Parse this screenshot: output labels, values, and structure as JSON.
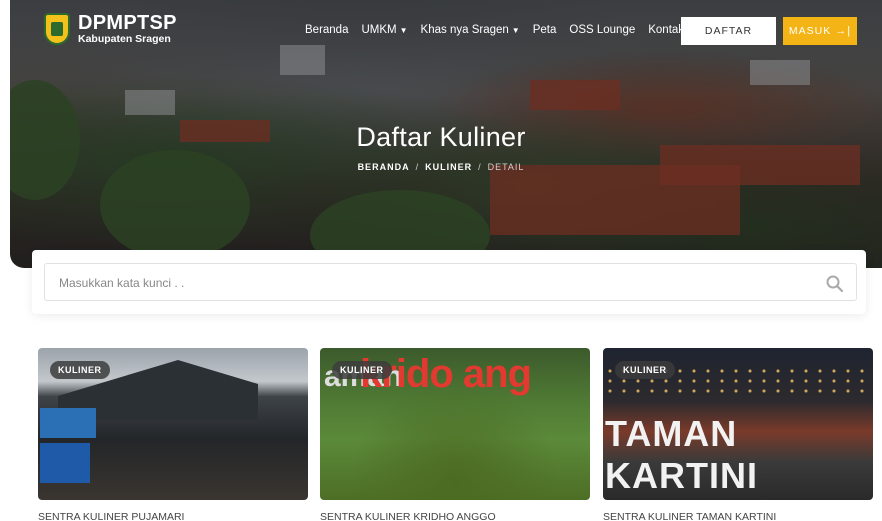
{
  "header": {
    "logo_title": "DPMPTSP",
    "logo_subtitle": "Kabupaten Sragen",
    "nav": [
      {
        "label": "Beranda",
        "has_dropdown": false
      },
      {
        "label": "UMKM",
        "has_dropdown": true
      },
      {
        "label": "Khas nya Sragen",
        "has_dropdown": true
      },
      {
        "label": "Peta",
        "has_dropdown": false
      },
      {
        "label": "OSS Lounge",
        "has_dropdown": false
      },
      {
        "label": "Kontak",
        "has_dropdown": true
      }
    ],
    "register_label": "DAFTAR",
    "login_label": "MASUK",
    "login_icon": "sign-in-icon",
    "accent_color": "#f5b415"
  },
  "hero": {
    "title": "Daftar Kuliner",
    "breadcrumb": [
      "BERANDA",
      "KULINER",
      "DETAIL"
    ]
  },
  "search": {
    "placeholder": "Masukkan kata kunci . .",
    "value": "",
    "icon": "search-icon"
  },
  "cards": [
    {
      "tag": "KULINER",
      "title": "SENTRA KULINER PUJAMARI"
    },
    {
      "tag": "KULINER",
      "title": "SENTRA KULINER KRIDHO ANGGO",
      "image_text": "taman kridoangg",
      "image_text_a": "aman",
      "image_text_b": "krido ang"
    },
    {
      "tag": "KULINER",
      "title": "SENTRA KULINER TAMAN KARTINI",
      "image_text": "TAMAN KARTINI"
    }
  ]
}
